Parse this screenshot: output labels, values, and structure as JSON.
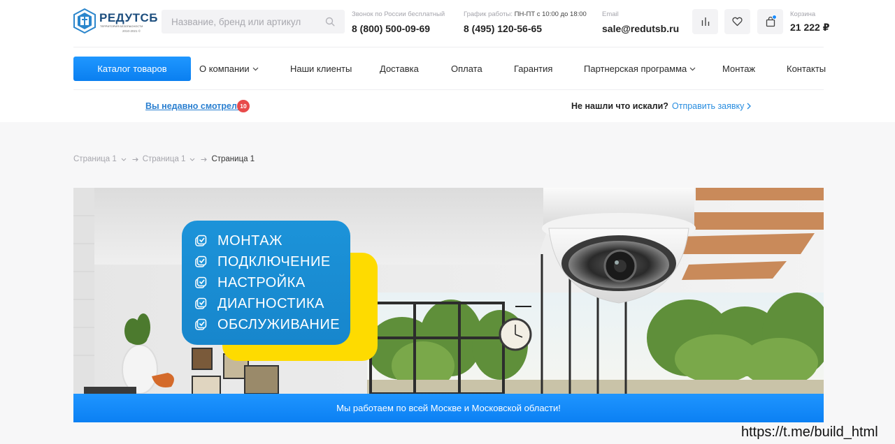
{
  "brand": {
    "name": "РЕДУТСБ",
    "tagline": "ТЕРРИТОРИЯ БЕЗОПАСНОСТИ",
    "years": "2010-2021 ©"
  },
  "search": {
    "placeholder": "Название, бренд или артикул"
  },
  "contacts": {
    "phone_free_label": "Звонок по России бесплатный",
    "phone_free": "8 (800) 500-09-69",
    "schedule_label": "График работы:",
    "schedule_value": "ПН-ПТ с 10:00 до 18:00",
    "phone_moscow": "8 (495) 120-56-65",
    "email_label": "Email",
    "email": "sale@redutsb.ru"
  },
  "cart": {
    "label": "Корзина",
    "total": "21 222 ₽"
  },
  "nav": {
    "catalog": "Каталог товаров",
    "items": [
      "О компании",
      "Наши клиенты",
      "Доставка",
      "Оплата",
      "Гарантия",
      "Партнерская программа",
      "Монтаж",
      "Контакты"
    ]
  },
  "subbar": {
    "recent_label": "Вы недавно смотрели",
    "recent_count": "10",
    "not_found": "Не нашли что искали?",
    "send_request": "Отправить заявку"
  },
  "breadcrumb": {
    "crumb_1": "Страница 1",
    "crumb_2": "Страница 1",
    "current": "Страница 1"
  },
  "banner": {
    "services": [
      "МОНТАЖ",
      "ПОДКЛЮЧЕНИЕ",
      "НАСТРОЙКА",
      "ДИАГНОСТИКА",
      "ОБСЛУЖИВАНИЕ"
    ],
    "strip_text": "Мы работаем по всей Москве и Московской области!"
  },
  "watermark": "https://t.me/build_html",
  "colors": {
    "accent": "#1a8cff",
    "link": "#2a8ee0",
    "badge": "#e84a4a",
    "card_blue": "#1c93d9",
    "card_yellow": "#fedb00"
  }
}
